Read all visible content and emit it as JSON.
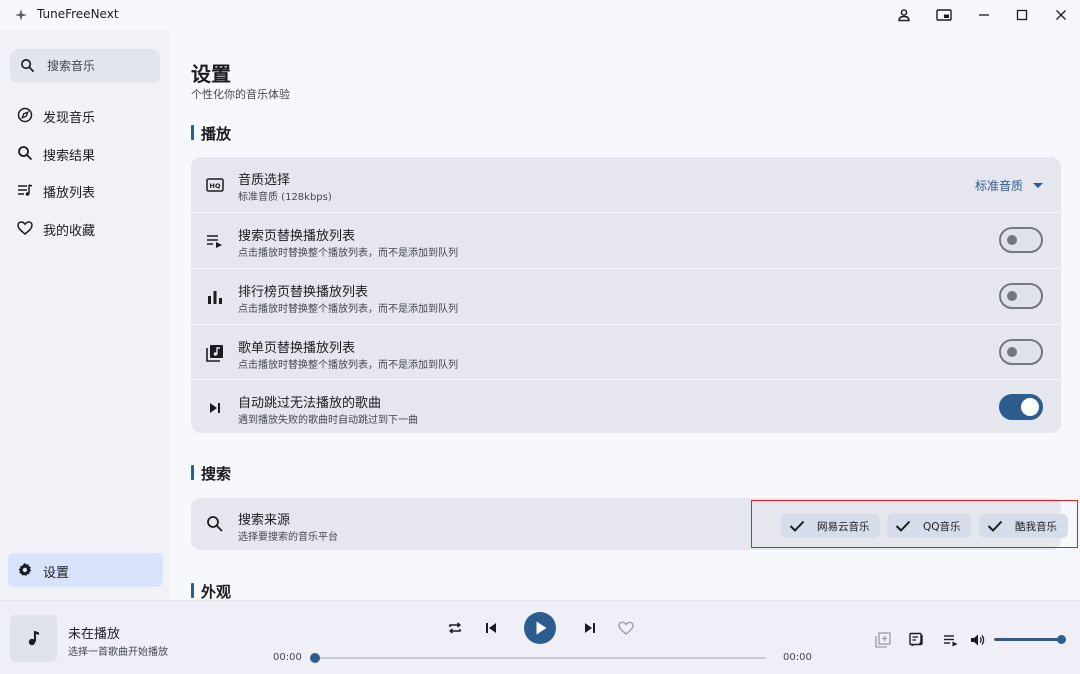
{
  "app": {
    "title": "TuneFreeNext"
  },
  "sidebar": {
    "search_placeholder": "搜索音乐",
    "items": [
      {
        "label": "发现音乐",
        "icon": "compass-icon"
      },
      {
        "label": "搜索结果",
        "icon": "search-icon"
      },
      {
        "label": "播放列表",
        "icon": "queue-music-icon"
      },
      {
        "label": "我的收藏",
        "icon": "heart-icon"
      }
    ],
    "settings_label": "设置"
  },
  "page": {
    "title": "设置",
    "subtitle": "个性化你的音乐体验"
  },
  "sections": {
    "playback": {
      "title": "播放",
      "quality": {
        "title": "音质选择",
        "subtitle": "标准音质 (128kbps)",
        "value": "标准音质"
      },
      "rows": [
        {
          "title": "搜索页替换播放列表",
          "subtitle": "点击播放时替换整个播放列表，而不是添加到队列",
          "enabled": false
        },
        {
          "title": "排行榜页替换播放列表",
          "subtitle": "点击播放时替换整个播放列表，而不是添加到队列",
          "enabled": false
        },
        {
          "title": "歌单页替换播放列表",
          "subtitle": "点击播放时替换整个播放列表，而不是添加到队列",
          "enabled": false
        },
        {
          "title": "自动跳过无法播放的歌曲",
          "subtitle": "遇到播放失败的歌曲时自动跳过到下一曲",
          "enabled": true
        }
      ]
    },
    "search": {
      "title": "搜索",
      "source": {
        "title": "搜索来源",
        "subtitle": "选择要搜索的音乐平台"
      },
      "platforms": [
        "网易云音乐",
        "QQ音乐",
        "酷我音乐"
      ]
    },
    "appearance": {
      "title": "外观"
    }
  },
  "player": {
    "title": "未在播放",
    "subtitle": "选择一首歌曲开始播放",
    "current_time": "00:00",
    "total_time": "00:00",
    "progress": 0,
    "volume": 1.0
  },
  "colors": {
    "accent": "#2d5c8e",
    "highlight_border": "#e02020"
  }
}
